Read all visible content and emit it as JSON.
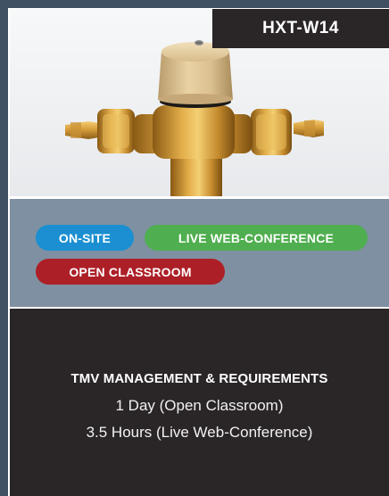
{
  "card": {
    "product_code": "HXT-W14",
    "product_image": "thermostatic-mixing-valve"
  },
  "tags": [
    {
      "label": "ON-SITE",
      "color": "#1b8fd1"
    },
    {
      "label": "LIVE WEB-CONFERENCE",
      "color": "#4fae4f"
    },
    {
      "label": "OPEN CLASSROOM",
      "color": "#ad1f27"
    }
  ],
  "course": {
    "title": "TMV MANAGEMENT & REQUIREMENTS",
    "durations": [
      "1 Day (Open Classroom)",
      "3.5 Hours (Live Web-Conference)"
    ]
  },
  "colors": {
    "page_background": "#3f5163",
    "badge_background": "#2a2526",
    "tags_background": "#7e90a1",
    "info_background": "#2a2526"
  }
}
